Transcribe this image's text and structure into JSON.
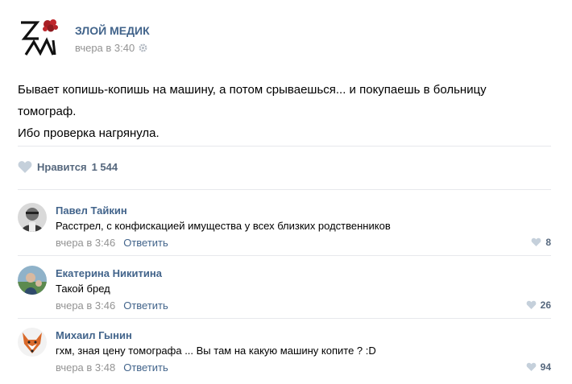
{
  "post": {
    "group_name": "ЗЛОЙ МЕДИК",
    "time": "вчера в 3:40",
    "text_lines": [
      "Бывает копишь-копишь на машину, а потом срываешься... и покупаешь в больницу",
      "томограф.",
      "Ибо проверка нагрянула."
    ],
    "likes_label": "Нравится",
    "likes_count": "1 544"
  },
  "comments": [
    {
      "author": "Павел Тайкин",
      "text": "Расстрел, с конфискацией имущества у всех близких родственников",
      "time": "вчера в 3:46",
      "reply": "Ответить",
      "likes": "8"
    },
    {
      "author": "Екатерина Никитина",
      "text": "Такой бред",
      "time": "вчера в 3:46",
      "reply": "Ответить",
      "likes": "26"
    },
    {
      "author": "Михаил Гынин",
      "text": "гхм, зная цену томографа ... Вы там на какую машину копите ? :D",
      "time": "вчера в 3:48",
      "reply": "Ответить",
      "likes": "94"
    }
  ],
  "icons": {
    "group_logo": "zm-logo-icon",
    "settings": "gear-icon",
    "like": "heart-icon"
  },
  "colors": {
    "link": "#42648b",
    "muted": "#939393",
    "heart": "#c5d0db",
    "divider": "#e7e8ec"
  }
}
